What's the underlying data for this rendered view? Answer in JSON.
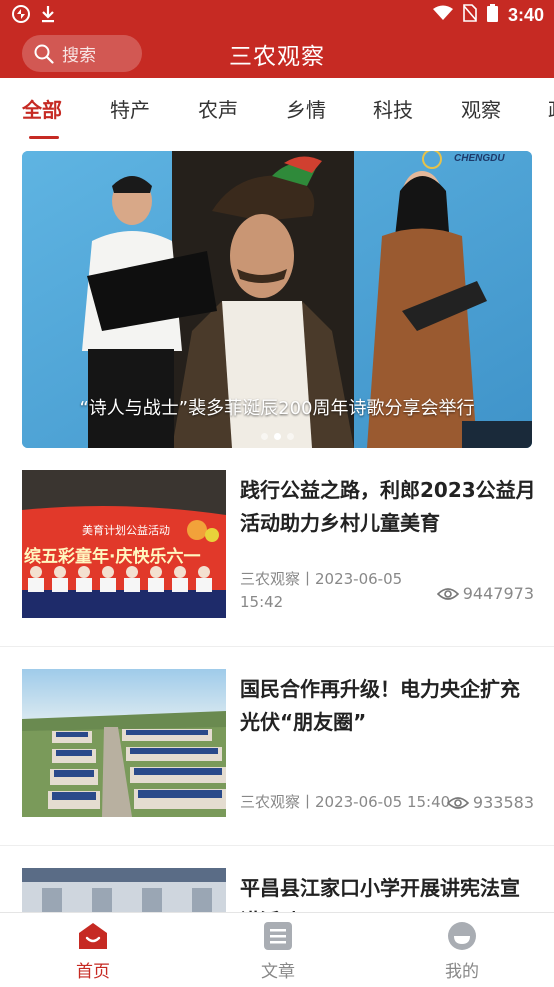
{
  "status_bar": {
    "time": "3:40",
    "accent_color": "#c62a23"
  },
  "header": {
    "title": "三农观察",
    "search_placeholder": "搜索"
  },
  "tabs": [
    {
      "label": "全部",
      "active": true
    },
    {
      "label": "特产",
      "active": false
    },
    {
      "label": "农声",
      "active": false
    },
    {
      "label": "乡情",
      "active": false
    },
    {
      "label": "科技",
      "active": false
    },
    {
      "label": "观察",
      "active": false
    },
    {
      "label": "政",
      "active": false
    }
  ],
  "banner": {
    "caption": "“诗人与战士”裴多菲诞辰200周年诗歌分享会举行",
    "logo_text": "CHENGDU",
    "active_dot": 1,
    "dot_count": 3
  },
  "news": [
    {
      "title": "践行公益之路，利郎2023公益月活动助力乡村儿童美育",
      "meta": "三农观察丨2023-06-05 15:42",
      "views": "9447973",
      "thumb_text_1": "美育计划公益活动",
      "thumb_text_2": "缤五彩童年·庆快乐六一"
    },
    {
      "title": "国民合作再升级！电力央企扩充光伏“朋友圈”",
      "meta": "三农观察丨2023-06-05 15:40",
      "views": "933583"
    },
    {
      "title": "平昌县江家口小学开展讲宪法宣讲活动"
    }
  ],
  "bottom_nav": [
    {
      "label": "首页",
      "icon": "home-icon",
      "active": true
    },
    {
      "label": "文章",
      "icon": "article-icon",
      "active": false
    },
    {
      "label": "我的",
      "icon": "profile-icon",
      "active": false
    }
  ]
}
